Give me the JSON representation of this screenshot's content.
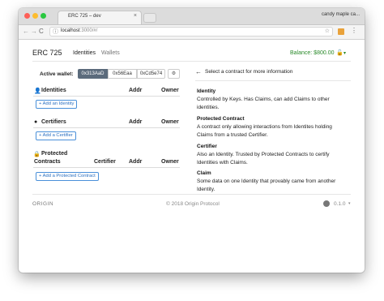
{
  "browser": {
    "tab_title": "ERC 725 – dev",
    "tab_close": "×",
    "profile": "candy maple ca...",
    "url_host": "localhost",
    "url_rest": ":3000/#/",
    "url_info_icon": "ⓘ",
    "star_icon": "☆",
    "menu_icon": "⋮",
    "back_icon": "←",
    "forward_icon": "→",
    "reload_icon": "C"
  },
  "header": {
    "brand": "ERC 725",
    "nav": [
      "Identities",
      "Wallets"
    ],
    "balance": "Balance: $800.00",
    "lock_icon": "🔓",
    "caret": "▾"
  },
  "active_wallet": {
    "label": "Active wallet:",
    "wallets": [
      "0x313AaD",
      "0x56Eaa",
      "0xCd5e74"
    ],
    "settings_icon": "⚙"
  },
  "sections": {
    "identities": {
      "icon": "👤",
      "title": "Identities",
      "cols": [
        "Addr",
        "Owner"
      ],
      "add_label": "+ Add an Identity"
    },
    "certifiers": {
      "icon": "●",
      "title": "Certifiers",
      "cols": [
        "Addr",
        "Owner"
      ],
      "add_label": "+ Add a Certifier"
    },
    "protected": {
      "icon": "🔒",
      "title_line1": "Protected",
      "title_line2": "Contracts",
      "cols": [
        "Certifier",
        "Addr",
        "Owner"
      ],
      "add_label": "+ Add a Protected Contract"
    }
  },
  "right_panel": {
    "arrow": "←",
    "message": "Select a contract for more information",
    "definitions": [
      {
        "term": "Identity",
        "desc": "Controlled by Keys. Has Claims, can add Claims to other identities."
      },
      {
        "term": "Protected Contract",
        "desc": "A contract only allowing interactions from Identites holding Claims from a trusted Certifier."
      },
      {
        "term": "Certifier",
        "desc": "Also an Identity. Trusted by Protected Contracts to certify Identities with Claims."
      },
      {
        "term": "Claim",
        "desc": "Some data on one Identity that provably came from another Identity."
      }
    ]
  },
  "footer": {
    "logo": "ORIGIN",
    "copyright": "© 2018 Origin Protocol",
    "version": "0.1.0",
    "version_caret": "▾"
  }
}
